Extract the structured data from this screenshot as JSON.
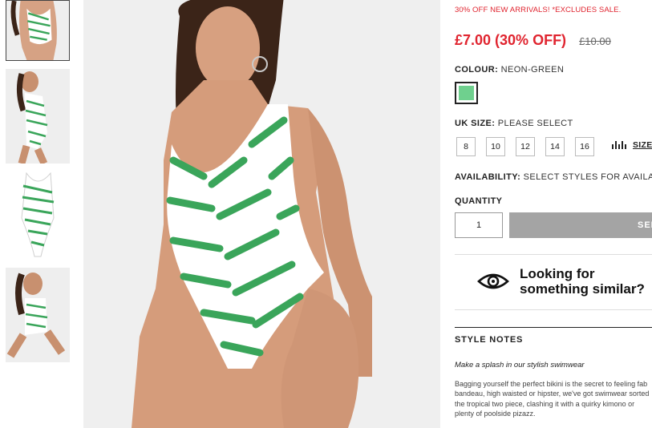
{
  "gallery": {
    "thumbnails": [
      {
        "label": "thumbnail-front"
      },
      {
        "label": "thumbnail-side"
      },
      {
        "label": "thumbnail-flat"
      },
      {
        "label": "thumbnail-seated"
      }
    ]
  },
  "product": {
    "promo_text": "30% OFF NEW ARRIVALS! *EXCLUDES SALE.",
    "price_now": "£7.00 (30% OFF)",
    "price_was": "£10.00",
    "colour_label": "COLOUR:",
    "colour_value": "NEON-GREEN",
    "swatch_color": "#6fd08e",
    "size_label": "UK SIZE:",
    "size_value": "PLEASE SELECT",
    "sizes": [
      "8",
      "10",
      "12",
      "14",
      "16"
    ],
    "size_guide_label": "SIZE",
    "availability_label": "AVAILABILITY:",
    "availability_value": "SELECT STYLES FOR AVAILABILITY",
    "quantity_label": "QUANTITY",
    "quantity_value": "1",
    "add_button_label": "SELECT SIZE",
    "similar_line1": "Looking for",
    "similar_line2": "something similar?",
    "style_notes_title": "STYLE NOTES",
    "style_tagline": "Make a splash in our stylish swimwear",
    "style_body": [
      "Bagging yourself the perfect bikini is the secret to feeling fab",
      "bandeau, high waisted or hipster, we've got swimwear sorted",
      "the tropical two piece, clashing it with a quirky kimono or",
      "plenty of poolside pizazz."
    ]
  },
  "colors": {
    "price_red": "#e0242f",
    "print_green": "#3aa55a",
    "button_grey": "#a4a4a4"
  }
}
